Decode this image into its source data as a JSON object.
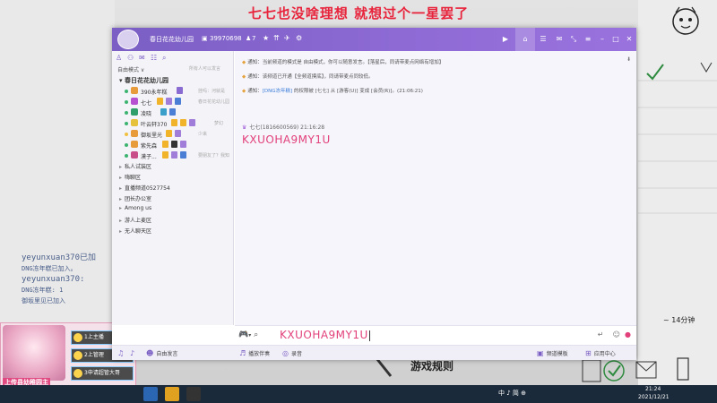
{
  "overlay": {
    "banner": "七七也没啥理想  就想过个一星罢了",
    "tiny_label": "",
    "timer": "~ 14分钟",
    "rules": "游戏规则",
    "chat_log": [
      "yeyunxuan370已加",
      "DNG冻年糕已加入。",
      "yeyunxuan370:",
      "DNG冻年糕: 1",
      "御坂里见已加入"
    ]
  },
  "streamer_card": {
    "caption": "上传县幼稚园主",
    "buttons": [
      "1上主播",
      "2上管理",
      "3申请超管大哥"
    ]
  },
  "titlebar": {
    "room_name": "春日花花幼儿园",
    "room_id": "39970698",
    "online_count": "7"
  },
  "sidebar": {
    "filter_label": "自由模式 ∨",
    "hint": "所有人可以发言",
    "root_channel": "春日花花幼儿园",
    "members": [
      {
        "name": "390永年糕",
        "status": "挂吗：河就是"
      },
      {
        "name": "七七",
        "status": "春日花花幼儿园"
      },
      {
        "name": "凌晓",
        "status": ""
      },
      {
        "name": "叶云轩370",
        "status": "梦幻"
      },
      {
        "name": "御坂里光",
        "status": "少来"
      },
      {
        "name": "紫先森",
        "status": ""
      },
      {
        "name": "漠子...",
        "status": "要朋友了？我知"
      }
    ],
    "sub_channels": [
      "私人试装区",
      "嗨聊区",
      "直播频道0527754",
      "团长办公室",
      "Among us",
      "游人上麦区",
      "无人聊天区"
    ]
  },
  "messages": {
    "notices": [
      {
        "prefix": "通知：",
        "text": "当前频道的模式是 自由模式，你可以随意发言。【落星后，同请带麦点网络有增加】"
      },
      {
        "prefix": "通知：",
        "text": "该频道已开通【全频道摸底】，同请带麦点同较低。"
      },
      {
        "prefix": "通知：",
        "highlight": "[DNG冻年糕]",
        "text": " 的权限被 [七七] 从 [游客(U)] 变成 [会员(R)]。(21:06:21)"
      }
    ],
    "sender": "七七(1816600569)  21:16:28",
    "body": "KXUOHA9MY1U"
  },
  "input": {
    "value": "KXUOHA9MY1U"
  },
  "bottom_bar": {
    "mic_label": "自由发言",
    "music_label": "播放伴奏",
    "effects_label": "录音",
    "template_label": "频道模板",
    "app_center_label": "应用中心"
  },
  "taskbar": {
    "tray_text": "中 ♪ 简 ⊕",
    "time": "21:24",
    "date": "2021/12/21"
  },
  "colors": {
    "title_purple": "#7b5fc4",
    "message_pink": "#e2407a",
    "banner_red": "#e8243c"
  }
}
